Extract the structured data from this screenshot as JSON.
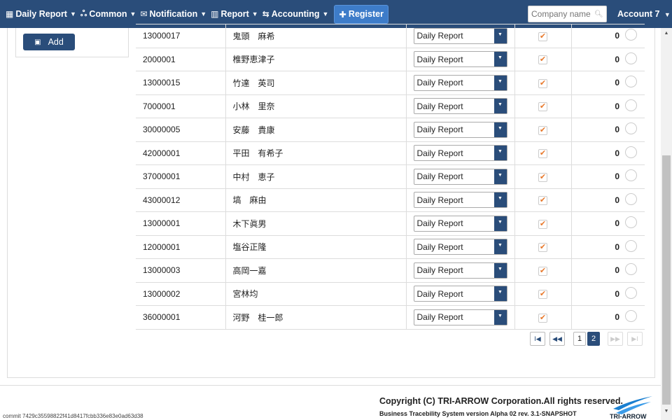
{
  "navbar": {
    "items": [
      {
        "icon": "calendar-icon",
        "glyph": "▦",
        "label": "Daily Report"
      },
      {
        "icon": "users-icon",
        "glyph": "ஃ",
        "label": "Common"
      },
      {
        "icon": "envelope-icon",
        "glyph": "✉",
        "label": "Notification"
      },
      {
        "icon": "bar-chart-icon",
        "glyph": "▥",
        "label": "Report"
      },
      {
        "icon": "exchange-icon",
        "glyph": "⇆",
        "label": "Accounting"
      }
    ],
    "register_label": "Register",
    "search_placeholder": "Company name",
    "account_label": "Account 7"
  },
  "left_panel": {
    "add_label": "Add"
  },
  "table": {
    "rows": [
      {
        "code": "13000017",
        "name": "鬼頭　麻希",
        "type": "Daily Report",
        "count": "0"
      },
      {
        "code": "2000001",
        "name": "椎野恵津子",
        "type": "Daily Report",
        "count": "0"
      },
      {
        "code": "13000015",
        "name": "竹達　英司",
        "type": "Daily Report",
        "count": "0"
      },
      {
        "code": "7000001",
        "name": "小林　里奈",
        "type": "Daily Report",
        "count": "0"
      },
      {
        "code": "30000005",
        "name": "安藤　貴康",
        "type": "Daily Report",
        "count": "0"
      },
      {
        "code": "42000001",
        "name": "平田　有希子",
        "type": "Daily Report",
        "count": "0"
      },
      {
        "code": "37000001",
        "name": "中村　恵子",
        "type": "Daily Report",
        "count": "0"
      },
      {
        "code": "43000012",
        "name": "塙　麻由",
        "type": "Daily Report",
        "count": "0"
      },
      {
        "code": "13000001",
        "name": "木下眞男",
        "type": "Daily Report",
        "count": "0"
      },
      {
        "code": "12000001",
        "name": "塩谷正隆",
        "type": "Daily Report",
        "count": "0"
      },
      {
        "code": "13000003",
        "name": "高岡一嘉",
        "type": "Daily Report",
        "count": "0"
      },
      {
        "code": "13000002",
        "name": "宮林均",
        "type": "Daily Report",
        "count": "0"
      },
      {
        "code": "36000001",
        "name": "河野　桂一郎",
        "type": "Daily Report",
        "count": "0"
      }
    ]
  },
  "pagination": {
    "first": "I◀",
    "prev": "◀◀",
    "pages": [
      "1",
      "2"
    ],
    "active_page": "2",
    "next": "▶▶",
    "last": "▶I"
  },
  "footer": {
    "copyright": "Copyright (C) TRI-ARROW Corporation.All rights reserved.",
    "version": "Business Tracebility System version Alpha 02 rev. 3.1-SNAPSHOT",
    "commit": "commit 7429c35598822f41d8417fcbb336e83e0ad63d38",
    "logo_text": "TRI-ARROW"
  },
  "colors": {
    "navbar": "#2a4d7a",
    "accent": "#3d7cc9",
    "check": "#e87a2e"
  }
}
